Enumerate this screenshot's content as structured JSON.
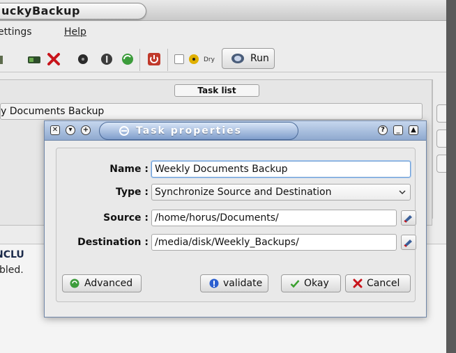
{
  "app": {
    "title": "uckyBackup"
  },
  "menu": {
    "items": [
      "ettings",
      "Help"
    ]
  },
  "toolbar": {
    "dry_label": "Dry",
    "run_label": "Run"
  },
  "task_list": {
    "header": "Task list",
    "items": [
      "kly Documents Backup"
    ]
  },
  "info": {
    "title": "NCLU",
    "text": "bled."
  },
  "dialog": {
    "title": "Task properties",
    "controls": [
      "?",
      "_",
      "▲"
    ],
    "name_label": "Name :",
    "name_value": "Weekly Documents Backup",
    "type_label": "Type :",
    "type_value": "Synchronize Source and Destination",
    "source_label": "Source :",
    "source_value": "/home/horus/Documents/",
    "destination_label": "Destination :",
    "destination_value": "/media/disk/Weekly_Backups/",
    "advanced_label": "Advanced",
    "validate_label": "validate",
    "okay_label": "Okay",
    "cancel_label": "Cancel"
  },
  "colors": {
    "dialog_title": "#8fa9cf",
    "okay_check": "#3aa02e",
    "cancel_x": "#c8141b",
    "validate_info": "#2b5fd0",
    "advanced_green": "#3c9c3b"
  }
}
